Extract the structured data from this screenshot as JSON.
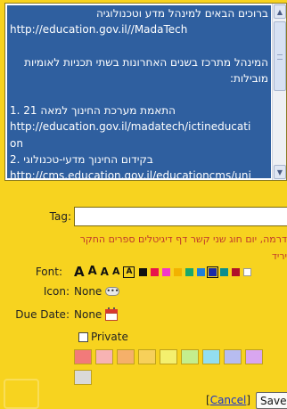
{
  "editor": {
    "lines": [
      {
        "dir": "rtl",
        "text": "ברוכים הבאים למינהל מדע וטכנולוגיה"
      },
      {
        "dir": "ltr",
        "text": "http://education.gov.il//MadaTech"
      },
      {
        "dir": "blank",
        "text": ""
      },
      {
        "dir": "rtl",
        "text": "המינהל מתרכז בשנים האחרונות בשתי תכניות לאומיות"
      },
      {
        "dir": "rtl",
        "text": "מובילות:"
      },
      {
        "dir": "blank",
        "text": ""
      },
      {
        "dir": "ltr",
        "text": "1. 21 התאמת מערכת החינוך למאה"
      },
      {
        "dir": "ltr",
        "text": "http://education.gov.il/madatech/ictineducati"
      },
      {
        "dir": "ltr",
        "text": "on"
      },
      {
        "dir": "ltr",
        "text": "2. בקידום החינוך מדעי-טכנולוגי"
      },
      {
        "dir": "ltr",
        "text": "http://cms.education.gov.il/educationcms/uni"
      }
    ]
  },
  "form": {
    "tag_label": "Tag:",
    "tag_value": "",
    "suggestions": "דרמה, יום חוג שני קשר דף דיגיטלים ספרים החקר יריד",
    "font_label": "Font:",
    "font_sizes": [
      "A",
      "A",
      "A",
      "A",
      "A"
    ],
    "font_colors": [
      "#111111",
      "#e8134b",
      "#f236c8",
      "#f2b200",
      "#1aa86b",
      "#1e7fd9",
      "#1a2aa6",
      "#0b8e8e",
      "#b0112a",
      "#ffffff"
    ],
    "selected_color_index": 6,
    "icon_label": "Icon:",
    "icon_value": "None",
    "due_label": "Due Date:",
    "due_value": "None",
    "private_label": "Private",
    "note_colors": [
      "#f27a7a",
      "#f7b3b3",
      "#f5b06a",
      "#f7d05a",
      "#f4f06e",
      "#c4ee8d",
      "#93def0",
      "#b7bcf0",
      "#d9a6f0",
      "#d9d9d9"
    ],
    "cancel_label": "Cancel",
    "save_label": "Save"
  }
}
